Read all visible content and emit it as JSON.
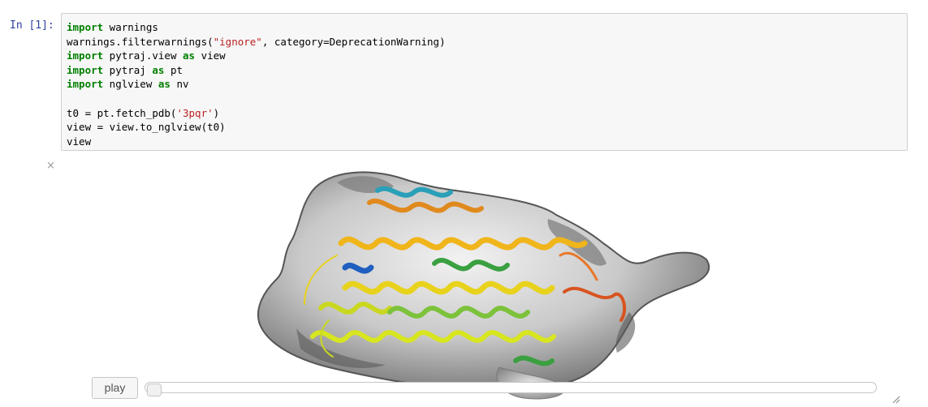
{
  "cell": {
    "prompt": "In [1]:",
    "code_lines": [
      [
        {
          "t": "import",
          "c": "kw"
        },
        {
          "t": " warnings",
          "c": ""
        }
      ],
      [
        {
          "t": "warnings.filterwarnings(",
          "c": ""
        },
        {
          "t": "\"ignore\"",
          "c": "str"
        },
        {
          "t": ", category=DeprecationWarning)",
          "c": ""
        }
      ],
      [
        {
          "t": "import",
          "c": "kw"
        },
        {
          "t": " pytraj.view ",
          "c": ""
        },
        {
          "t": "as",
          "c": "kw"
        },
        {
          "t": " view",
          "c": ""
        }
      ],
      [
        {
          "t": "import",
          "c": "kw"
        },
        {
          "t": " pytraj ",
          "c": ""
        },
        {
          "t": "as",
          "c": "kw"
        },
        {
          "t": " pt",
          "c": ""
        }
      ],
      [
        {
          "t": "import",
          "c": "kw"
        },
        {
          "t": " nglview ",
          "c": ""
        },
        {
          "t": "as",
          "c": "kw"
        },
        {
          "t": " nv",
          "c": ""
        }
      ],
      [],
      [
        {
          "t": "t0 = pt.fetch_pdb(",
          "c": ""
        },
        {
          "t": "'3pqr'",
          "c": "str"
        },
        {
          "t": ")",
          "c": ""
        }
      ],
      [
        {
          "t": "view = view.to_nglview(t0)",
          "c": ""
        }
      ],
      [
        {
          "t": "view",
          "c": ""
        }
      ]
    ]
  },
  "output": {
    "close_symbol": "×",
    "viewer_label": "protein-3d-view",
    "play_label": "play",
    "slider_value": 0,
    "colors": {
      "surface": "#9a9a9a",
      "helix_colors": [
        "#1f5fbf",
        "#2aa0b8",
        "#e08a1e",
        "#f0b51a",
        "#e8d21c",
        "#c9d81f",
        "#7cc23a",
        "#3aa040",
        "#d8541f"
      ]
    }
  }
}
